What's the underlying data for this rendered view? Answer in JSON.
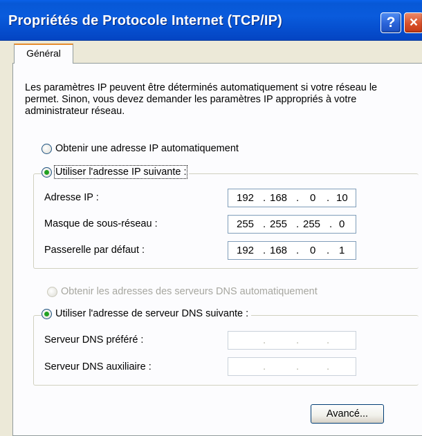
{
  "window": {
    "title": "Propriétés de Protocole Internet (TCP/IP)",
    "help_glyph": "?",
    "close_glyph": "×"
  },
  "tabs": [
    {
      "label": "Général",
      "active": true
    }
  ],
  "intro": "Les paramètres IP peuvent être déterminés automatiquement si votre réseau le permet. Sinon, vous devez demander les paramètres IP appropriés à votre administrateur réseau.",
  "ip_section": {
    "auto_option": {
      "label": "Obtenir une adresse IP automatiquement",
      "selected": false
    },
    "manual_option": {
      "label": "Utiliser l'adresse IP suivante :",
      "selected": true
    },
    "fields": [
      {
        "label": "Adresse IP :",
        "octets": [
          "192",
          "168",
          "0",
          "10"
        ]
      },
      {
        "label": "Masque de sous-réseau :",
        "octets": [
          "255",
          "255",
          "255",
          "0"
        ]
      },
      {
        "label": "Passerelle par défaut :",
        "octets": [
          "192",
          "168",
          "0",
          "1"
        ]
      }
    ]
  },
  "dns_section": {
    "auto_option": {
      "label": "Obtenir les adresses des serveurs DNS automatiquement",
      "enabled": false
    },
    "manual_option": {
      "label": "Utiliser l'adresse de serveur DNS suivante :",
      "selected": true
    },
    "fields": [
      {
        "label": "Serveur DNS préféré :",
        "octets": [
          "",
          "",
          "",
          ""
        ]
      },
      {
        "label": "Serveur DNS auxiliaire :",
        "octets": [
          "",
          "",
          "",
          ""
        ]
      }
    ]
  },
  "buttons": {
    "advanced": "Avancé..."
  },
  "separator": "."
}
